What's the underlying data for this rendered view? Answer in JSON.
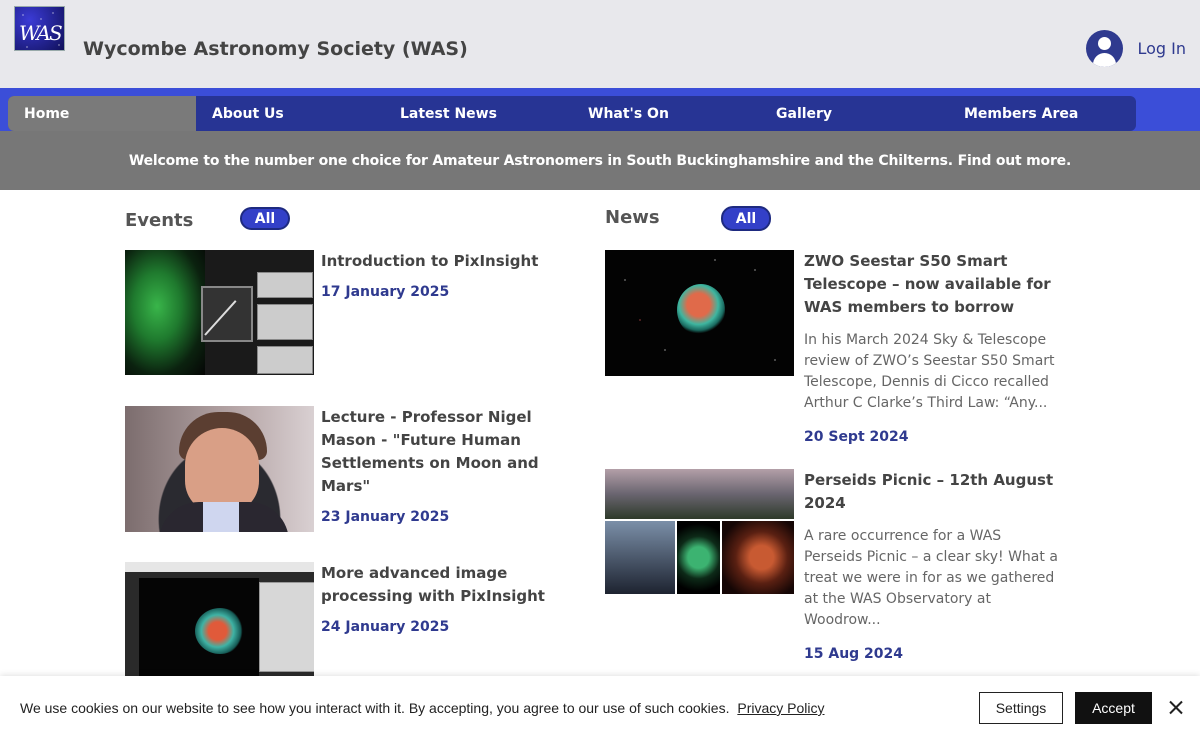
{
  "header": {
    "logo_text": "WAS",
    "site_title": "Wycombe Astronomy Society (WAS)",
    "login_label": "Log In"
  },
  "nav": {
    "items": [
      "Home",
      "About Us",
      "Latest News",
      "What's On",
      "Gallery",
      "Members Area"
    ],
    "active": "Home"
  },
  "banner": {
    "text": "Welcome to the number one choice for Amateur Astronomers in South Buckinghamshire and the Chilterns.  Find out more."
  },
  "events": {
    "title": "Events",
    "filter_label": "All",
    "items": [
      {
        "title_lines": [
          "Introduction to PixInsight"
        ],
        "date": "17 January 2025"
      },
      {
        "title_lines": [
          "Lecture - Professor Nigel",
          "Mason - \"Future Human",
          "Settlements on Moon and",
          "Mars\""
        ],
        "date": "23 January 2025"
      },
      {
        "title_lines": [
          "More advanced image",
          "processing with PixInsight"
        ],
        "date": "24 January 2025"
      }
    ]
  },
  "news": {
    "title": "News",
    "filter_label": "All",
    "items": [
      {
        "title_lines": [
          "ZWO Seestar S50 Smart",
          "Telescope – now available for",
          "WAS members to borrow"
        ],
        "desc_lines": [
          "In his March 2024 Sky & Telescope",
          "review of ZWO’s Seestar S50 Smart",
          "Telescope, Dennis di Cicco recalled",
          "Arthur C Clarke’s Third Law: “Any..."
        ],
        "date": "20 Sept 2024"
      },
      {
        "title_lines": [
          "Perseids Picnic – 12th August",
          "2024"
        ],
        "desc_lines": [
          "A rare occurrence for a WAS",
          "Perseids Picnic – a clear sky! What a",
          "treat we were in for as we gathered",
          "at the WAS Observatory at",
          "Woodrow..."
        ],
        "date": "15 Aug 2024"
      }
    ]
  },
  "cookie": {
    "message": "We use cookies on our website to see how you interact with it. By accepting, you agree to our use of such cookies.",
    "policy_link": "Privacy Policy",
    "settings_label": "Settings",
    "accept_label": "Accept"
  },
  "colors": {
    "nav_bar": "#3b4ed8",
    "nav_inner": "#273494",
    "accent_text": "#2f3a8f",
    "banner_bg": "#777777"
  }
}
